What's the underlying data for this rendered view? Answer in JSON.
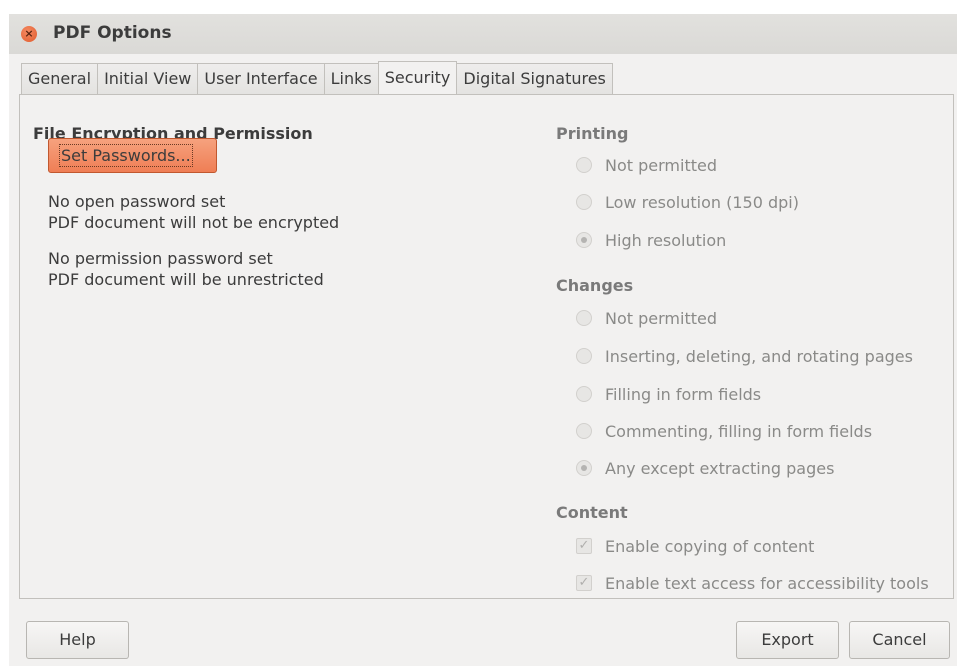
{
  "window": {
    "title": "PDF Options",
    "close_glyph": "×"
  },
  "tabs": [
    {
      "label": "General",
      "active": false
    },
    {
      "label": "Initial View",
      "active": false
    },
    {
      "label": "User Interface",
      "active": false
    },
    {
      "label": "Links",
      "active": false
    },
    {
      "label": "Security",
      "active": true
    },
    {
      "label": "Digital Signatures",
      "active": false
    }
  ],
  "encryption": {
    "title": "File Encryption and Permission",
    "set_passwords_label": "Set Passwords...",
    "open_status": "No open password set",
    "open_detail": "PDF document will not be encrypted",
    "perm_status": "No permission password set",
    "perm_detail": "PDF document will be unrestricted"
  },
  "printing": {
    "title": "Printing",
    "options": [
      {
        "label": "Not permitted",
        "checked": false
      },
      {
        "label": "Low resolution (150 dpi)",
        "checked": false
      },
      {
        "label": "High resolution",
        "checked": true
      }
    ]
  },
  "changes": {
    "title": "Changes",
    "options": [
      {
        "label": "Not permitted",
        "checked": false
      },
      {
        "label": "Inserting, deleting, and rotating pages",
        "checked": false
      },
      {
        "label": "Filling in form fields",
        "checked": false
      },
      {
        "label": "Commenting, filling in form fields",
        "checked": false
      },
      {
        "label": "Any except extracting pages",
        "checked": true
      }
    ]
  },
  "content": {
    "title": "Content",
    "options": [
      {
        "label": "Enable copying of content",
        "checked": true
      },
      {
        "label": "Enable text access for accessibility tools",
        "checked": true
      }
    ]
  },
  "footer": {
    "help_label": "Help",
    "export_label": "Export",
    "cancel_label": "Cancel"
  },
  "colors": {
    "accent": "#ef7e55",
    "window_bg": "#f2f1f0",
    "disabled_text": "#8a8a88"
  }
}
